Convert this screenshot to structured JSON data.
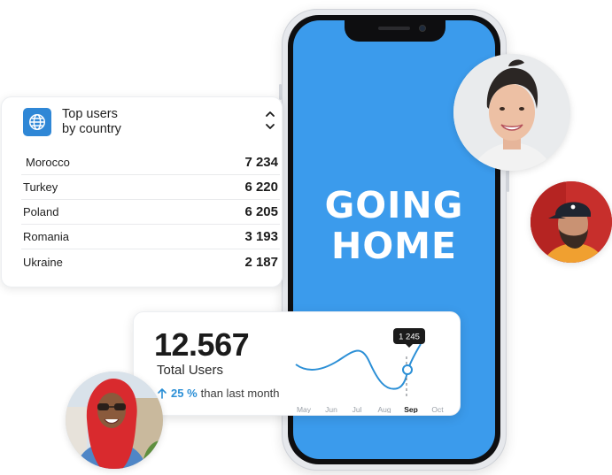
{
  "phone": {
    "headline": "GOING\nHOME",
    "screen_color": "#3b9bec"
  },
  "top_users": {
    "icon": "globe-icon",
    "title": "Top users\nby country",
    "rows": [
      {
        "country": "Morocco",
        "count": "7 234"
      },
      {
        "country": "Turkey",
        "count": "6 220"
      },
      {
        "country": "Poland",
        "count": "6 205"
      },
      {
        "country": "Romania",
        "count": "3 193"
      },
      {
        "country": "Ukraine",
        "count": "2 187"
      }
    ]
  },
  "total_users": {
    "value": "12.567",
    "label": "Total Users",
    "growth_icon": "arrow-up-icon",
    "growth_pct": "25 %",
    "growth_text": "than last month",
    "accent": "#2b8fd6"
  },
  "chart_data": {
    "type": "line",
    "categories": [
      "May",
      "Jun",
      "Jul",
      "Aug",
      "Sep",
      "Oct"
    ],
    "highlight": {
      "category": "Sep",
      "label": "1 245"
    },
    "curve_color": "#2b8fd6"
  },
  "avatars": [
    {
      "name": "woman-portrait"
    },
    {
      "name": "man-with-cap-portrait"
    },
    {
      "name": "woman-red-hijab-portrait"
    }
  ]
}
